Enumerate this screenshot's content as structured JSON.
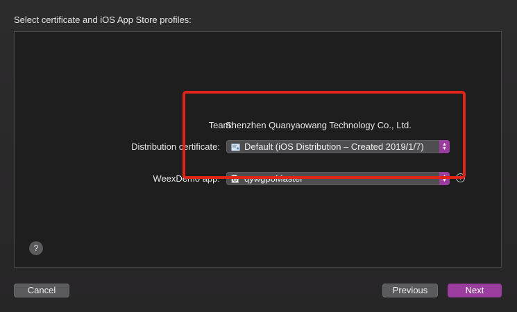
{
  "heading": "Select certificate and iOS App Store profiles:",
  "team": {
    "label": "Team:",
    "value": "Shenzhen Quanyaowang Technology Co., Ltd."
  },
  "distribution_certificate": {
    "label": "Distribution certificate:",
    "selected": "Default (iOS Distribution – Created 2019/1/7)",
    "icon": "certificate-icon"
  },
  "app_profile": {
    "label": "WeexDemo app:",
    "selected": "qywgpoMaster",
    "icon": "provisioning-profile-icon",
    "info_icon": "info-icon"
  },
  "help": {
    "label": "?"
  },
  "buttons": {
    "cancel": "Cancel",
    "previous": "Previous",
    "next": "Next"
  },
  "colors": {
    "accent": "#9b3d9e",
    "highlight": "#e0241a",
    "panel": "#1f1e1f"
  }
}
